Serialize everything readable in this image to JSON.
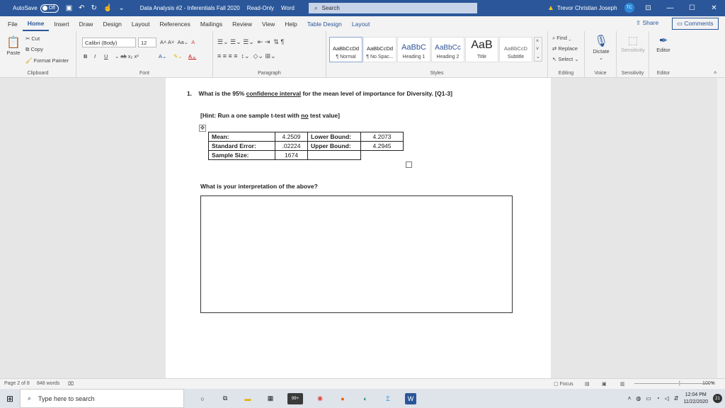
{
  "titlebar": {
    "autosave_label": "AutoSave",
    "autosave_state": "Off",
    "doc_title": "Data Analysis #2 - Inferentials Fall 2020",
    "read_only": "Read-Only",
    "app_name": "Word",
    "search_placeholder": "Search",
    "user_name": "Trevor Christian Joseph",
    "user_initials": "TC"
  },
  "menu": {
    "tabs": [
      "File",
      "Home",
      "Insert",
      "Draw",
      "Design",
      "Layout",
      "References",
      "Mailings",
      "Review",
      "View",
      "Help",
      "Table Design",
      "Layout"
    ],
    "active_tab": "Home",
    "share_label": "Share",
    "comments_label": "Comments"
  },
  "ribbon": {
    "clipboard": {
      "paste": "Paste",
      "cut": "Cut",
      "copy": "Copy",
      "format_painter": "Format Painter",
      "label": "Clipboard"
    },
    "font": {
      "name": "Calibri (Body)",
      "size": "12",
      "label": "Font"
    },
    "paragraph": {
      "label": "Paragraph"
    },
    "styles": {
      "label": "Styles",
      "items": [
        {
          "preview": "AaBbCcDd",
          "name": "¶ Normal"
        },
        {
          "preview": "AaBbCcDd",
          "name": "¶ No Spac..."
        },
        {
          "preview": "AaBbC",
          "name": "Heading 1"
        },
        {
          "preview": "AaBbCc",
          "name": "Heading 2"
        },
        {
          "preview": "AaB",
          "name": "Title"
        },
        {
          "preview": "AaBbCcD",
          "name": "Subtitle"
        }
      ]
    },
    "editing": {
      "find": "Find",
      "replace": "Replace",
      "select": "Select",
      "label": "Editing"
    },
    "voice": {
      "dictate": "Dictate",
      "label": "Voice"
    },
    "sensitivity": {
      "btn": "Sensitivity",
      "label": "Sensitivity"
    },
    "editor": {
      "btn": "Editor",
      "label": "Editor"
    }
  },
  "document": {
    "q1_number": "1.",
    "q1_pre": "What is the 95% ",
    "q1_link": "confidence interval",
    "q1_post": " for the mean level of importance for Diversity. [Q1-3]",
    "hint_pre": "[Hint: Run a one sample t-test with ",
    "hint_u": "no",
    "hint_post": " test value]",
    "table": {
      "mean_label": "Mean:",
      "mean": "4.2509",
      "lower_label": "Lower Bound:",
      "lower": "4.2073",
      "se_label": "Standard Error:",
      "se": ".02224",
      "upper_label": "Upper Bound:",
      "upper": "4.2945",
      "n_label": "Sample Size:",
      "n": "1674"
    },
    "q2": "What is your interpretation of the above?"
  },
  "statusbar": {
    "page": "Page 2 of 8",
    "words": "848 words",
    "focus": "Focus",
    "zoom": "100%"
  },
  "taskbar": {
    "search_placeholder": "Type here to search",
    "time": "12:04 PM",
    "date": "11/22/2020",
    "notifications": "21",
    "badge": "99+"
  }
}
